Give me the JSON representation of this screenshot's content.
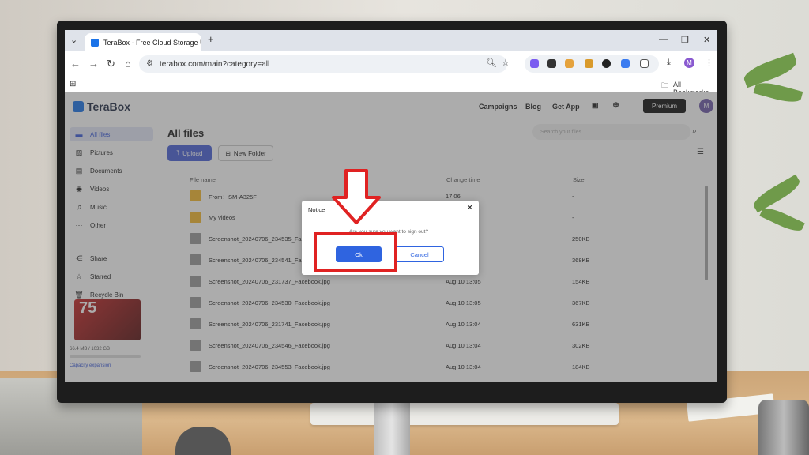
{
  "browser": {
    "tab_title": "TeraBox - Free Cloud Storage U",
    "url": "terabox.com/main?category=all",
    "bookmarks_label": "All Bookmarks"
  },
  "app": {
    "logo_text": "TeraBox",
    "nav": [
      "Campaigns",
      "Blog",
      "Get App"
    ],
    "premium_label": "Premium",
    "avatar_initial": "M"
  },
  "sidebar": {
    "items": [
      {
        "label": "All files",
        "icon": "folder-icon",
        "active": true
      },
      {
        "label": "Pictures",
        "icon": "image-icon"
      },
      {
        "label": "Documents",
        "icon": "document-icon"
      },
      {
        "label": "Videos",
        "icon": "video-icon"
      },
      {
        "label": "Music",
        "icon": "headphones-icon"
      },
      {
        "label": "Other",
        "icon": "more-icon"
      },
      {
        "label": "Share",
        "icon": "share-icon"
      },
      {
        "label": "Starred",
        "icon": "star-icon"
      },
      {
        "label": "Recycle Bin",
        "icon": "trash-icon"
      }
    ],
    "promo_text": "75",
    "storage_text": "66.4 MB / 1032 GB",
    "storage_fraction": 0.0001,
    "capacity_link": "Capacity expansion"
  },
  "main": {
    "title": "All files",
    "upload_label": "Upload",
    "new_folder_label": "New Folder",
    "search_placeholder": "Search your files",
    "columns": {
      "name": "File name",
      "time": "Change time",
      "size": "Size"
    },
    "rows": [
      {
        "name": "From：SM-A325F",
        "time": "17:06",
        "size": "-",
        "type": "folder"
      },
      {
        "name": "My videos",
        "time": "",
        "size": "-",
        "type": "folder"
      },
      {
        "name": "Screenshot_20240706_234535_Face",
        "time": "",
        "size": "250KB",
        "type": "image"
      },
      {
        "name": "Screenshot_20240706_234541_Face",
        "time": "",
        "size": "368KB",
        "type": "image"
      },
      {
        "name": "Screenshot_20240706_231737_Facebook.jpg",
        "time": "Aug 10 13:05",
        "size": "154KB",
        "type": "image"
      },
      {
        "name": "Screenshot_20240706_234530_Facebook.jpg",
        "time": "Aug 10 13:05",
        "size": "367KB",
        "type": "image"
      },
      {
        "name": "Screenshot_20240706_231741_Facebook.jpg",
        "time": "Aug 10 13:04",
        "size": "631KB",
        "type": "image"
      },
      {
        "name": "Screenshot_20240706_234546_Facebook.jpg",
        "time": "Aug 10 13:04",
        "size": "302KB",
        "type": "image"
      },
      {
        "name": "Screenshot_20240706_234553_Facebook.jpg",
        "time": "Aug 10 13:04",
        "size": "184KB",
        "type": "image"
      }
    ]
  },
  "dialog": {
    "title": "Notice",
    "message": "Are you sure you want to sign out?",
    "ok_label": "Ok",
    "cancel_label": "Cancel"
  },
  "colors": {
    "highlight": "#e02222",
    "primary": "#2f64e0",
    "folder": "#f5b82e"
  }
}
